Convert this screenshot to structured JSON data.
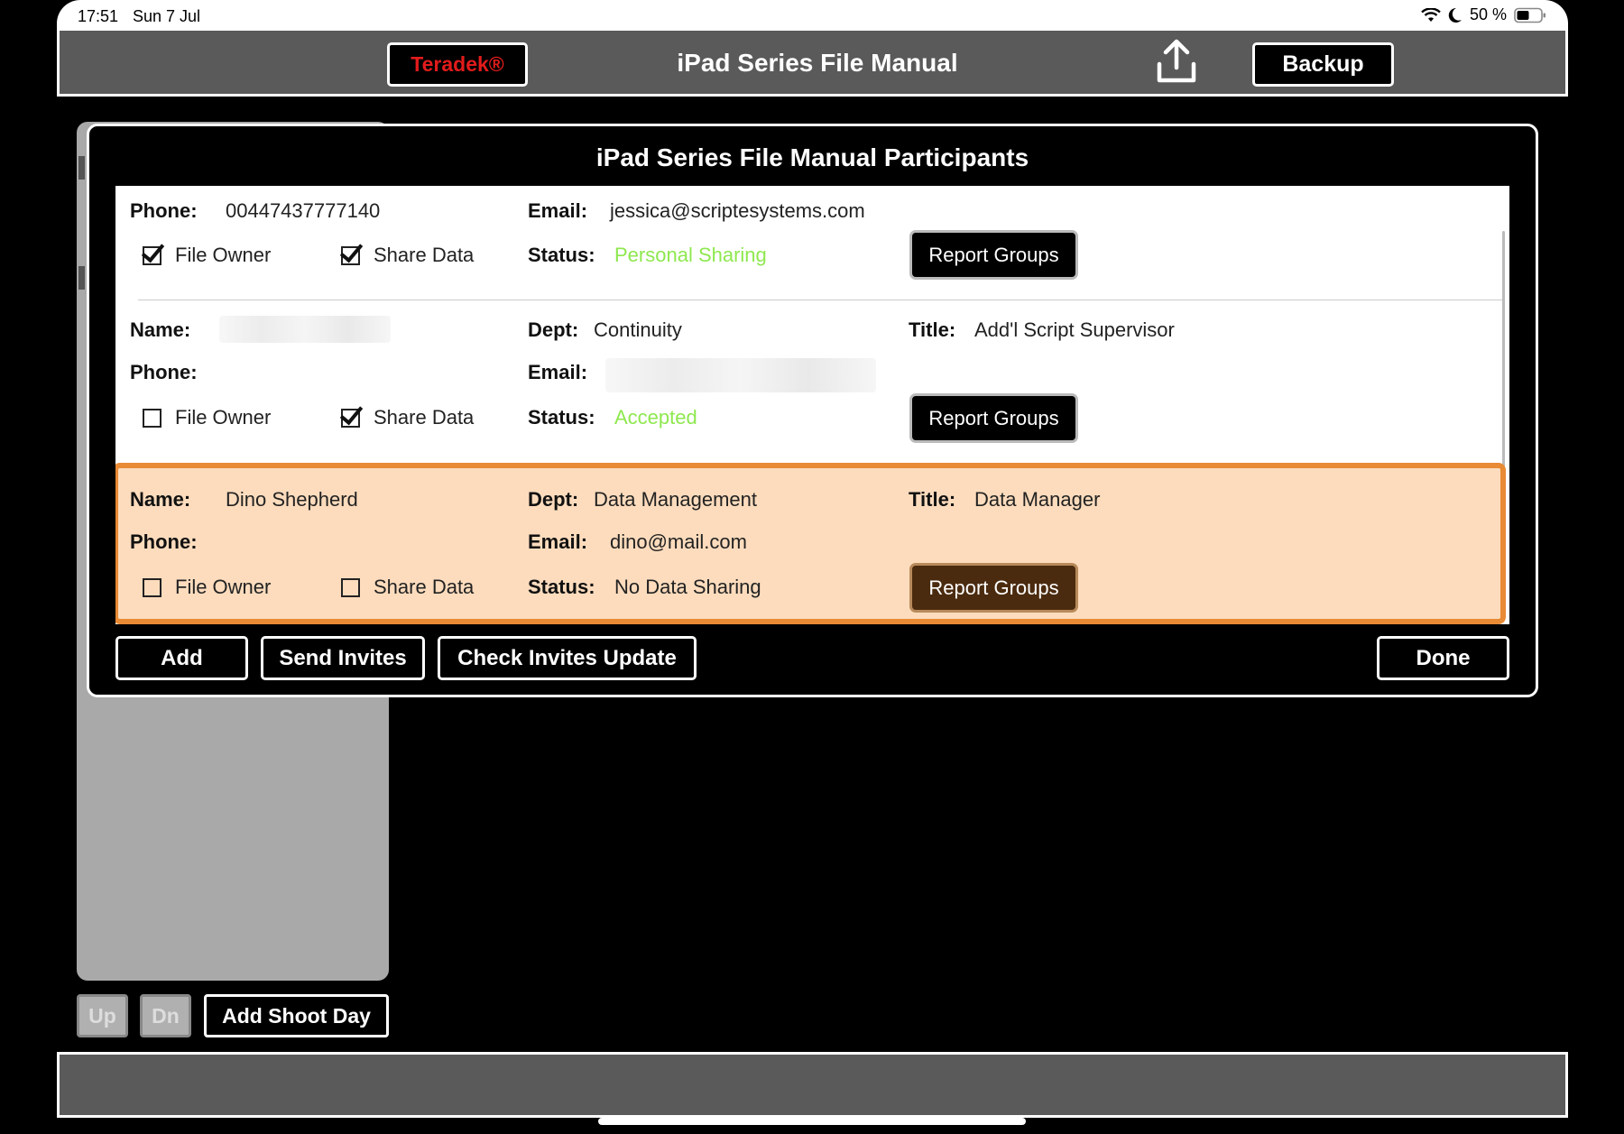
{
  "status_bar": {
    "time": "17:51",
    "date": "Sun 7 Jul",
    "battery": "50 %"
  },
  "nav": {
    "brand": "Teradek®",
    "title": "iPad Series File Manual",
    "backup_label": "Backup"
  },
  "background": {
    "up_label": "Up",
    "dn_label": "Dn",
    "add_shoot_day_label": "Add Shoot Day"
  },
  "modal": {
    "title": "iPad Series File Manual Participants",
    "labels": {
      "name": "Name:",
      "phone": "Phone:",
      "email": "Email:",
      "dept": "Dept:",
      "title": "Title:",
      "status": "Status:",
      "file_owner": "File Owner",
      "share_data": "Share Data",
      "report_groups": "Report Groups"
    },
    "participants": [
      {
        "phone": "00447437777140",
        "email": "jessica@scriptesystems.com",
        "status": "Personal Sharing",
        "status_color": "#8ee84e",
        "file_owner": true,
        "share_data": true
      },
      {
        "name": "",
        "dept": "Continuity",
        "title": "Add'l Script Supervisor",
        "phone": "",
        "email": "",
        "status": "Accepted",
        "status_color": "#8ee84e",
        "file_owner": false,
        "share_data": true
      },
      {
        "name": "Dino Shepherd",
        "dept": "Data Management",
        "title": "Data Manager",
        "phone": "",
        "email": "dino@mail.com",
        "status": "No Data Sharing",
        "file_owner": false,
        "share_data": false,
        "selected": true
      }
    ],
    "buttons": {
      "add": "Add",
      "send_invites": "Send Invites",
      "check_invites_update": "Check Invites Update",
      "done": "Done"
    },
    "highlight_color": "#e98a35"
  },
  "icons": {
    "share": "upload-share-icon",
    "wifi": "wifi-icon",
    "moon": "moon-icon",
    "battery": "battery-icon"
  }
}
